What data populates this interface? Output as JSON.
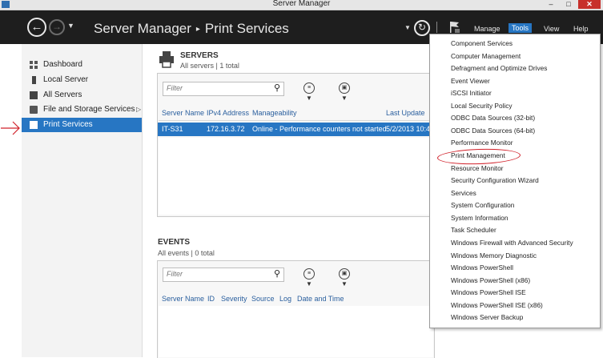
{
  "window": {
    "title": "Server Manager",
    "minimize": "–",
    "maximize": "□",
    "close": "✕"
  },
  "header": {
    "breadcrumb_root": "Server Manager",
    "breadcrumb_separator": "▸",
    "breadcrumb_current": "Print Services",
    "menus": {
      "manage": "Manage",
      "tools": "Tools",
      "view": "View",
      "help": "Help"
    }
  },
  "sidebar": {
    "items": [
      {
        "label": "Dashboard"
      },
      {
        "label": "Local Server"
      },
      {
        "label": "All Servers"
      },
      {
        "label": "File and Storage Services"
      },
      {
        "label": "Print Services"
      }
    ]
  },
  "servers": {
    "title": "SERVERS",
    "subtitle": "All servers | 1 total",
    "filter_placeholder": "Filter",
    "columns": [
      "Server Name",
      "IPv4 Address",
      "Manageability",
      "Last Update"
    ],
    "rows": [
      {
        "name": "IT-S31",
        "ip": "172.16.3.72",
        "manageability": "Online - Performance counters not started",
        "last_update": "5/2/2013 10:4"
      }
    ]
  },
  "events": {
    "title": "EVENTS",
    "subtitle": "All events | 0 total",
    "filter_placeholder": "Filter",
    "columns": [
      "Server Name",
      "ID",
      "Severity",
      "Source",
      "Log",
      "Date and Time"
    ]
  },
  "tools_menu": {
    "items": [
      "Component Services",
      "Computer Management",
      "Defragment and Optimize Drives",
      "Event Viewer",
      "iSCSI Initiator",
      "Local Security Policy",
      "ODBC Data Sources (32-bit)",
      "ODBC Data Sources (64-bit)",
      "Performance Monitor",
      "Print Management",
      "Resource Monitor",
      "Security Configuration Wizard",
      "Services",
      "System Configuration",
      "System Information",
      "Task Scheduler",
      "Windows Firewall with Advanced Security",
      "Windows Memory Diagnostic",
      "Windows PowerShell",
      "Windows PowerShell (x86)",
      "Windows PowerShell ISE",
      "Windows PowerShell ISE (x86)",
      "Windows Server Backup"
    ],
    "highlighted": "Print Management"
  },
  "colors": {
    "accent": "#2776c3",
    "header_bg": "#1e1e1e",
    "annotation": "#d1222b"
  }
}
